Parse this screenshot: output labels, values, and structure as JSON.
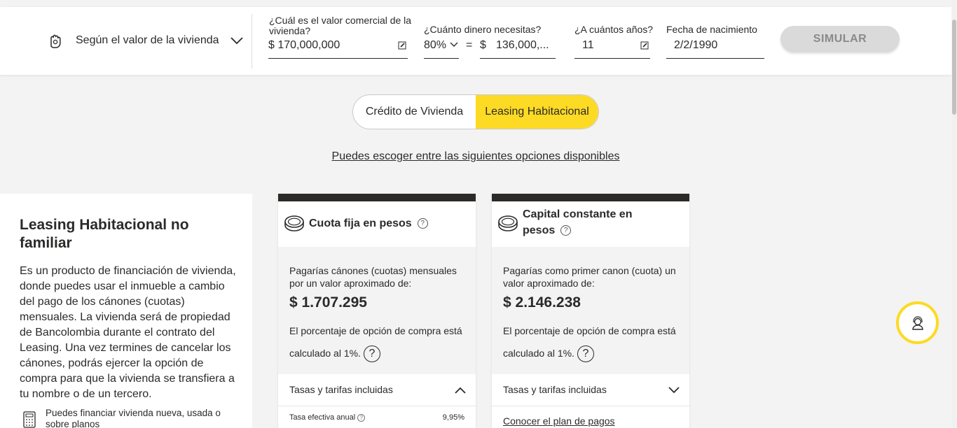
{
  "topbar": {
    "mode_label": "Según el valor de la vivienda",
    "fields": {
      "value": {
        "label": "¿Cuál es el valor comercial de la vivienda?",
        "value": "$ 170,000,000"
      },
      "amount": {
        "label": "¿Cuánto dinero necesitas?",
        "percent": "80%",
        "equals": "=",
        "currency": "$",
        "value": "136,000,..."
      },
      "years": {
        "label": "¿A cuántos años?",
        "value": "11"
      },
      "birth": {
        "label": "Fecha de nacimiento",
        "value": "2/2/1990"
      }
    },
    "simulate_label": "SIMULAR"
  },
  "toggle": {
    "option1": "Crédito de Vivienda",
    "option2": "Leasing Habitacional",
    "selected": "Leasing Habitacional"
  },
  "options_link": "Puedes escoger entre las siguientes opciones disponibles",
  "info": {
    "title": "Leasing Habitacional no familiar",
    "description": "Es un producto de financiación de vivienda, donde puedes usar el inmueble a cambio del pago de los cánones (cuotas) mensuales. La vivienda será de propiedad de Bancolombia durante el contrato del Leasing. Una vez termines de cancelar los cánones, podrás ejercer la opción de compra para que la vivienda se transfiera a tu nombre o de un tercero.",
    "note": "Puedes financiar vivienda nueva, usada o sobre planos"
  },
  "cards": [
    {
      "title": "Cuota fija en pesos",
      "help": "?",
      "description": "Pagarías cánones (cuotas) mensuales por un valor aproximado de:",
      "amount": "$ 1.707.295",
      "percent_text": "El porcentaje de opción de compra está calculado al 1%.",
      "rates_label": "Tasas y tarifas incluidas",
      "rate_row_label": "Tasa efectiva anual",
      "rate_row_value": "9,95%"
    },
    {
      "title": "Capital constante en pesos",
      "help": "?",
      "description": "Pagarías como primer canon (cuota) un valor aproximado de:",
      "amount": "$ 2.146.238",
      "percent_text": "El porcentaje de opción de compra está calculado al 1%.",
      "rates_label": "Tasas y tarifas incluidas",
      "plan_link": "Conocer el plan de pagos"
    }
  ],
  "colors": {
    "brand_yellow": "#fdda24",
    "text_dark": "#2c2a29",
    "background": "#f3f3f3",
    "button_disabled": "#dadada"
  }
}
